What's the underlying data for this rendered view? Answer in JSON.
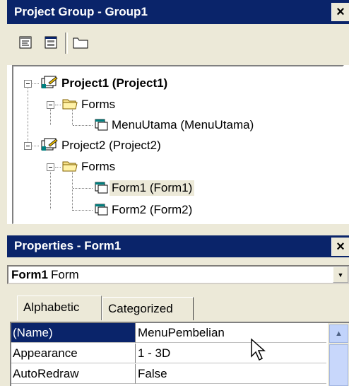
{
  "project_group": {
    "title": "Project Group - Group1",
    "close_glyph": "×",
    "toolbar": [
      {
        "name": "view-code-icon"
      },
      {
        "name": "view-object-icon"
      },
      {
        "name": "toggle-folders-icon"
      }
    ],
    "tree": {
      "project1": {
        "label": "Project1 (Project1)"
      },
      "forms1": {
        "label": "Forms"
      },
      "menuutama": {
        "label": "MenuUtama (MenuUtama)"
      },
      "project2": {
        "label": "Project2 (Project2)"
      },
      "forms2": {
        "label": "Forms"
      },
      "form1": {
        "label": "Form1 (Form1)"
      },
      "form2": {
        "label": "Form2 (Form2)"
      }
    }
  },
  "properties": {
    "title": "Properties - Form1",
    "close_glyph": "×",
    "object_selector": {
      "name": "Form1",
      "type": "Form",
      "arrow": "▼"
    },
    "tabs": [
      "Alphabetic",
      "Categorized"
    ],
    "active_tab": "Alphabetic",
    "rows": [
      {
        "name": "(Name)",
        "value": "MenuPembelian"
      },
      {
        "name": "Appearance",
        "value": "1 - 3D"
      },
      {
        "name": "AutoRedraw",
        "value": "False"
      }
    ],
    "scroll_up_glyph": "▲"
  },
  "colors": {
    "titlebar": "#0a246a",
    "selection": "#0a246a",
    "face": "#ece9d8"
  }
}
